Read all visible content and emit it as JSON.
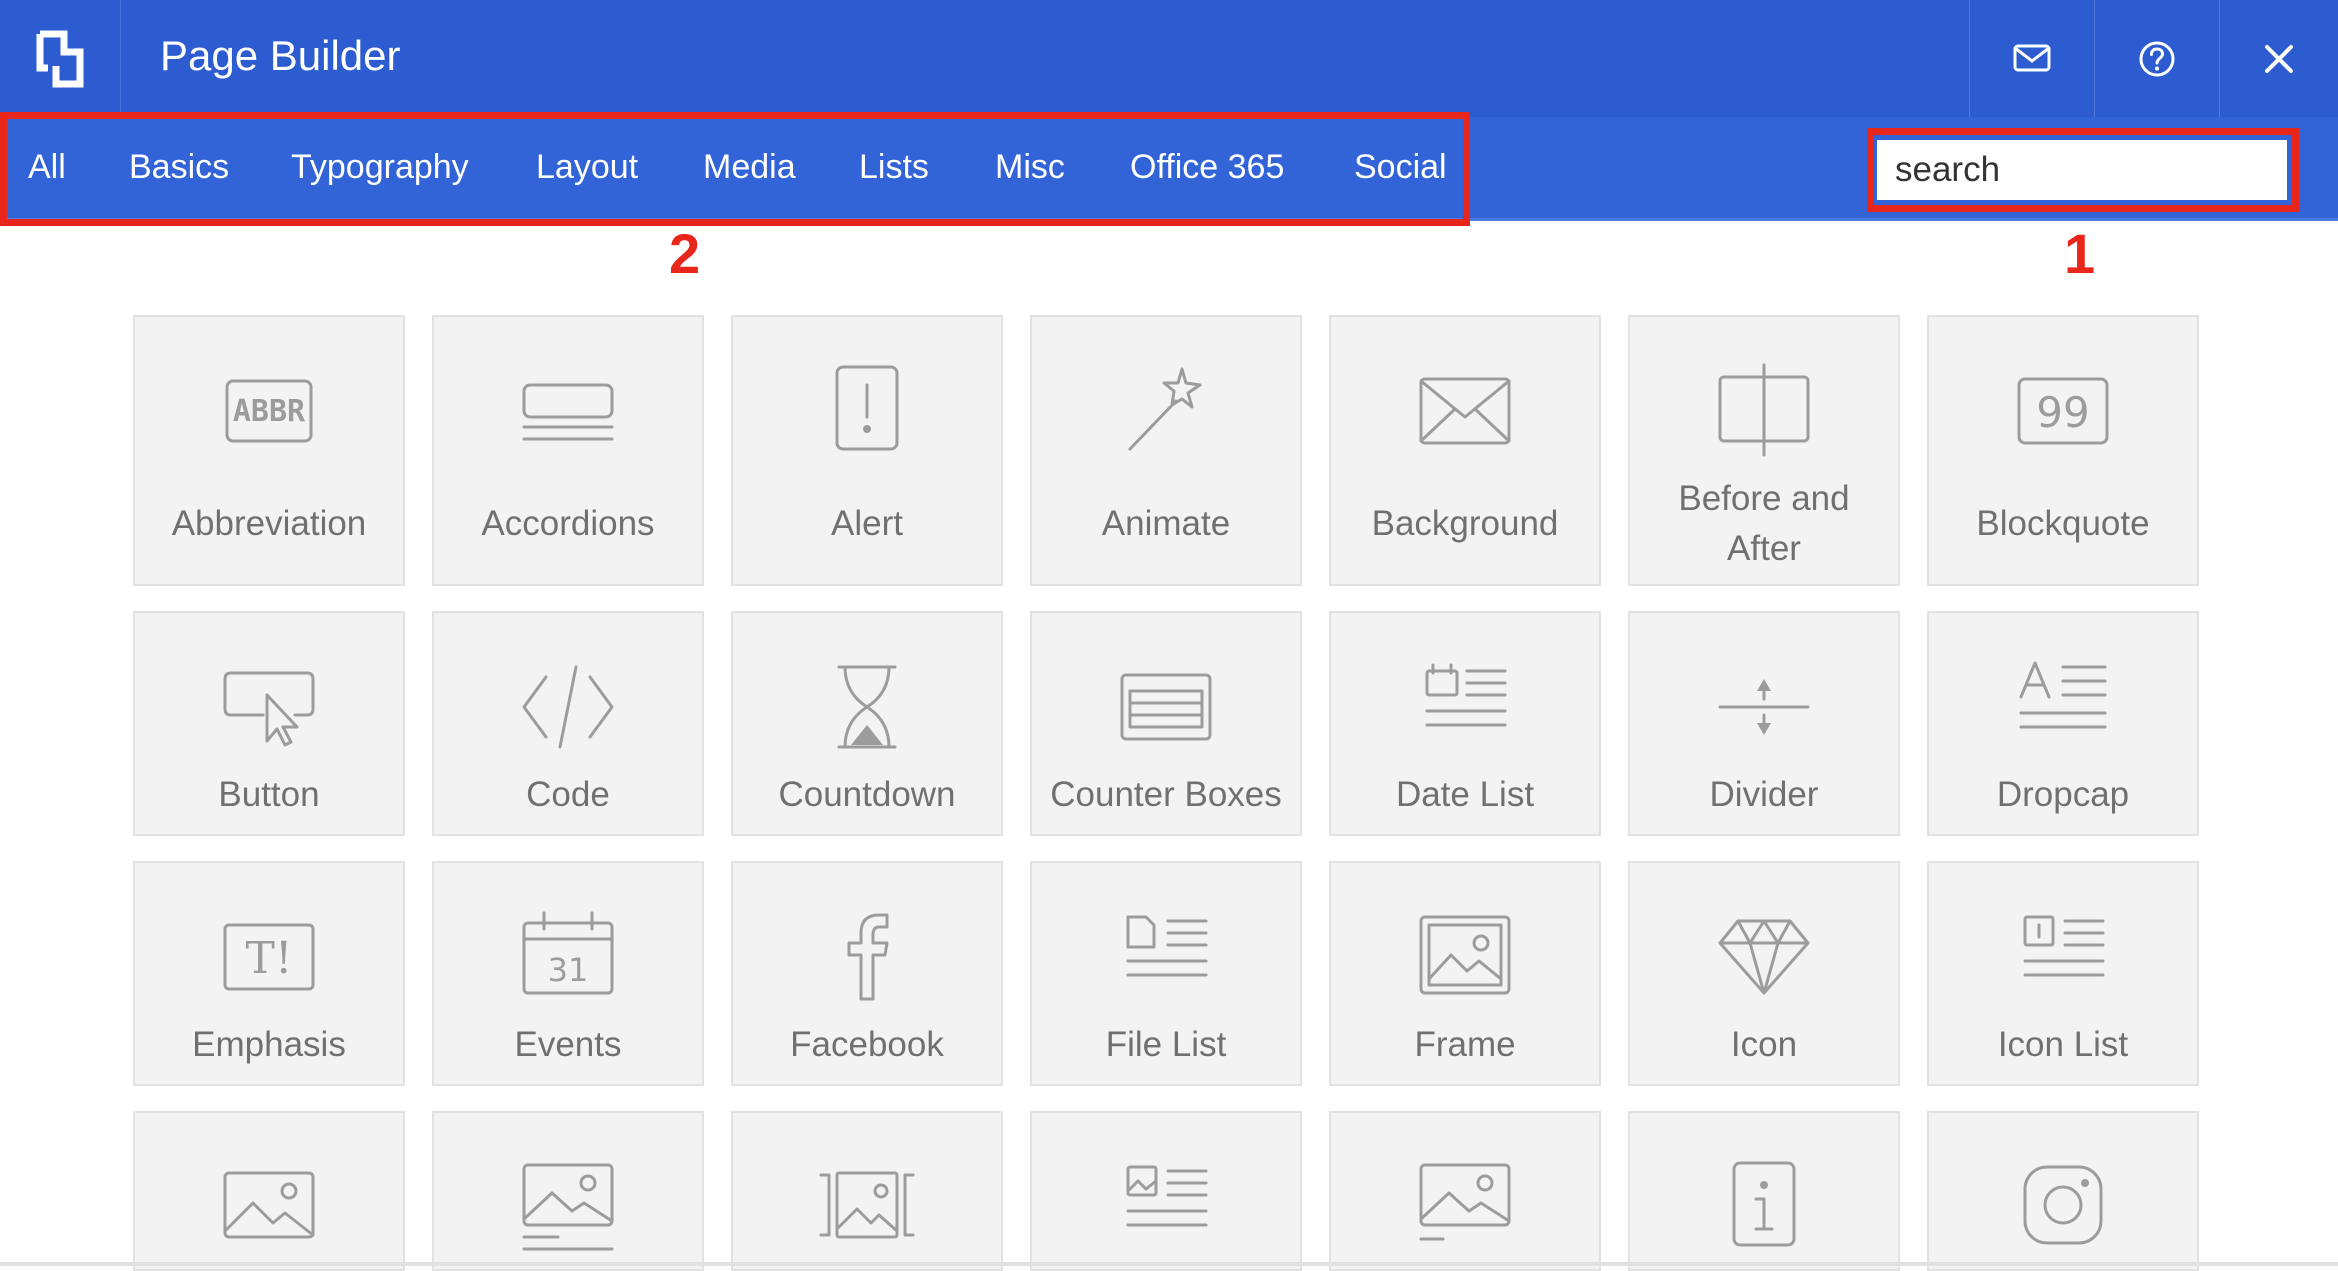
{
  "header": {
    "title": "Page Builder",
    "logo_icon": "page-builder-logo",
    "buttons": [
      {
        "name": "mail-icon"
      },
      {
        "name": "help-icon"
      },
      {
        "name": "close-icon"
      }
    ],
    "colors": {
      "header_bg": "#2c5ccf",
      "tabbar_bg": "#3264d8",
      "highlight": "#e8261b"
    }
  },
  "tabs": [
    "All",
    "Basics",
    "Typography",
    "Layout",
    "Media",
    "Lists",
    "Misc",
    "Office 365",
    "Social"
  ],
  "search": {
    "placeholder": "search",
    "value": ""
  },
  "annotations": {
    "search_marker": "1",
    "tabs_marker": "2"
  },
  "tiles": [
    {
      "label": "Abbreviation",
      "icon": "abbr-icon"
    },
    {
      "label": "Accordions",
      "icon": "accordions-icon"
    },
    {
      "label": "Alert",
      "icon": "alert-icon"
    },
    {
      "label": "Animate",
      "icon": "magic-wand-icon"
    },
    {
      "label": "Background",
      "icon": "envelope-background-icon"
    },
    {
      "label": "Before and After",
      "icon": "before-after-icon"
    },
    {
      "label": "Blockquote",
      "icon": "blockquote-icon"
    },
    {
      "label": "Button",
      "icon": "button-cursor-icon"
    },
    {
      "label": "Code",
      "icon": "code-icon"
    },
    {
      "label": "Countdown",
      "icon": "hourglass-icon"
    },
    {
      "label": "Counter Boxes",
      "icon": "counter-boxes-icon"
    },
    {
      "label": "Date List",
      "icon": "date-list-icon"
    },
    {
      "label": "Divider",
      "icon": "divider-icon"
    },
    {
      "label": "Dropcap",
      "icon": "dropcap-icon"
    },
    {
      "label": "Emphasis",
      "icon": "emphasis-icon"
    },
    {
      "label": "Events",
      "icon": "calendar-icon"
    },
    {
      "label": "Facebook",
      "icon": "facebook-icon"
    },
    {
      "label": "File List",
      "icon": "file-list-icon"
    },
    {
      "label": "Frame",
      "icon": "frame-icon"
    },
    {
      "label": "Icon",
      "icon": "diamond-icon"
    },
    {
      "label": "Icon List",
      "icon": "icon-list-icon"
    },
    {
      "label": "",
      "icon": "image-icon"
    },
    {
      "label": "",
      "icon": "image-caption-icon"
    },
    {
      "label": "",
      "icon": "image-gallery-icon"
    },
    {
      "label": "",
      "icon": "image-list-icon"
    },
    {
      "label": "",
      "icon": "image-card-icon"
    },
    {
      "label": "",
      "icon": "info-icon"
    },
    {
      "label": "",
      "icon": "instagram-icon"
    }
  ]
}
